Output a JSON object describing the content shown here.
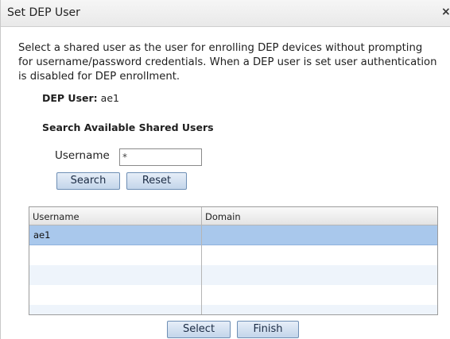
{
  "dialog": {
    "title": "Set DEP User",
    "close_label": "×",
    "description": "Select a shared user as the user for enrolling DEP devices without prompting for username/password credentials. When a DEP user is set user authentication is disabled for DEP enrollment.",
    "dep_user_label": "DEP User:",
    "dep_user_value": "ae1",
    "search_heading": "Search Available Shared Users",
    "username_label": "Username",
    "username_value": "*",
    "search_button": "Search",
    "reset_button": "Reset",
    "select_button": "Select",
    "finish_button": "Finish"
  },
  "table": {
    "columns": [
      "Username",
      "Domain"
    ],
    "rows": [
      {
        "username": "ae1",
        "domain": ""
      }
    ]
  }
}
